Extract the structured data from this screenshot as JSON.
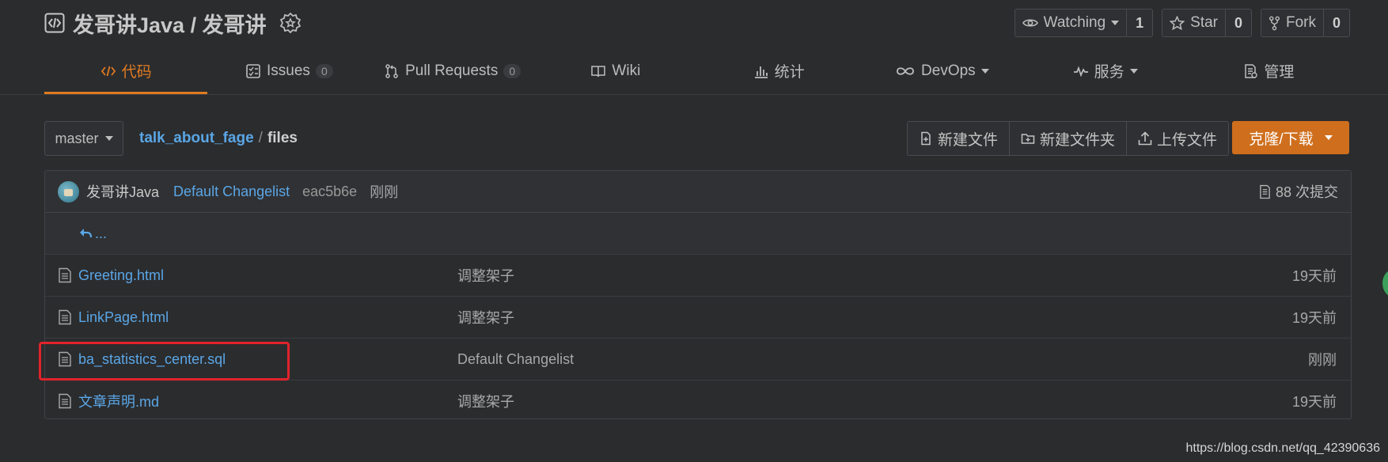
{
  "repo": {
    "title": "发哥讲Java / 发哥讲",
    "watch_label": "Watching",
    "watch_count": "1",
    "star_label": "Star",
    "star_count": "0",
    "fork_label": "Fork",
    "fork_count": "0"
  },
  "tabs": [
    {
      "label": "代码",
      "icon": "code-icon",
      "active": true
    },
    {
      "label": "Issues",
      "count": "0",
      "icon": "issues-icon"
    },
    {
      "label": "Pull Requests",
      "count": "0",
      "icon": "pull-request-icon"
    },
    {
      "label": "Wiki",
      "icon": "book-icon"
    },
    {
      "label": "统计",
      "icon": "bar-chart-icon"
    },
    {
      "label": "DevOps",
      "icon": "infinity-icon"
    },
    {
      "label": "服务",
      "icon": "pulse-icon"
    },
    {
      "label": "管理",
      "icon": "settings-doc-icon"
    }
  ],
  "toolbar": {
    "branch": "master",
    "path_root": "talk_about_fage",
    "path_sep": "/",
    "path_current": "files",
    "new_file": "新建文件",
    "new_folder": "新建文件夹",
    "upload_file": "上传文件",
    "clone": "克隆/下载"
  },
  "commit": {
    "author": "发哥讲Java",
    "message": "Default Changelist",
    "sha": "eac5b6e",
    "time": "刚刚",
    "count": "88 次提交"
  },
  "up_dir": "...",
  "files": [
    {
      "name": "Greeting.html",
      "message": "调整架子",
      "time": "19天前"
    },
    {
      "name": "LinkPage.html",
      "message": "调整架子",
      "time": "19天前"
    },
    {
      "name": "ba_statistics_center.sql",
      "message": "Default Changelist",
      "time": "刚刚"
    },
    {
      "name": "文章声明.md",
      "message": "调整架子",
      "time": "19天前"
    }
  ],
  "watermark": "https://blog.csdn.net/qq_42390636",
  "colors": {
    "accent": "#e07b22",
    "link": "#5aa6e6",
    "highlight": "#e0232b",
    "clone_button": "#cf6f1d"
  }
}
